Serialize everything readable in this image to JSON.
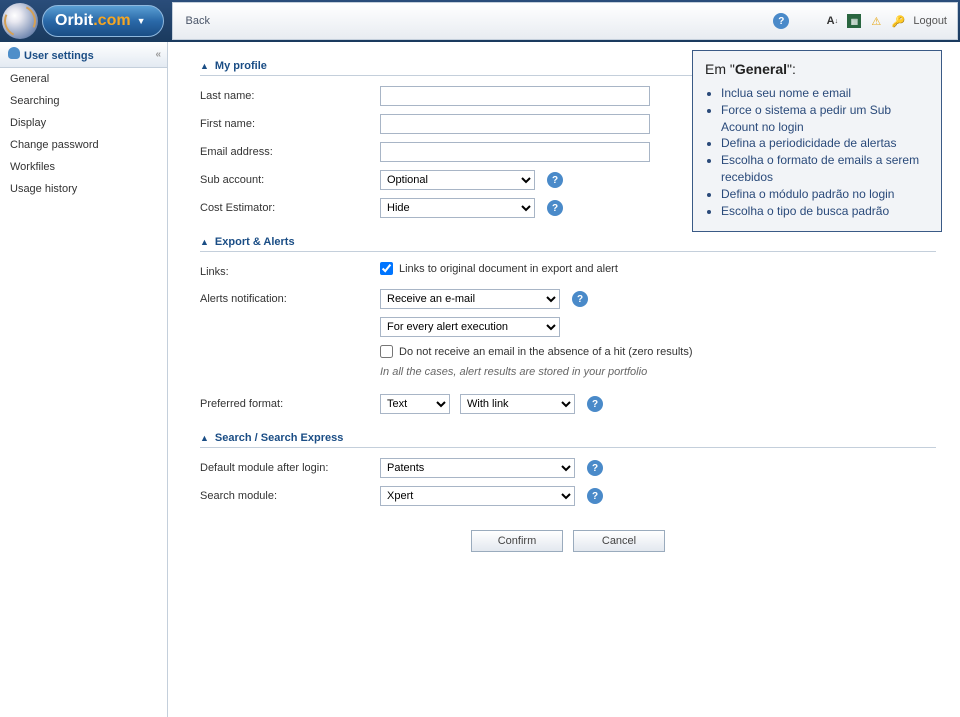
{
  "brand": {
    "name": "Orbit",
    "tld": ".com"
  },
  "topbar": {
    "back": "Back",
    "logout": "Logout"
  },
  "sidebar": {
    "title": "User settings",
    "items": [
      "General",
      "Searching",
      "Display",
      "Change password",
      "Workfiles",
      "Usage history"
    ]
  },
  "sections": {
    "profile": {
      "title": "My profile",
      "last_name_label": "Last name:",
      "first_name_label": "First name:",
      "email_label": "Email address:",
      "sub_account_label": "Sub account:",
      "sub_account_value": "Optional",
      "cost_estimator_label": "Cost Estimator:",
      "cost_estimator_value": "Hide"
    },
    "export": {
      "title": "Export & Alerts",
      "links_label": "Links:",
      "links_checkbox_label": "Links to original document in export and alert",
      "links_checked": true,
      "alerts_notif_label": "Alerts notification:",
      "alerts_notif_value": "Receive an e-mail",
      "alerts_freq_value": "For every alert execution",
      "no_receive_label": "Do not receive an email in the absence of a hit (zero results)",
      "no_receive_checked": false,
      "note": "In all the cases, alert results are stored in your portfolio",
      "preferred_format_label": "Preferred format:",
      "preferred_format_value": "Text",
      "preferred_link_value": "With link"
    },
    "search": {
      "title": "Search / Search Express",
      "default_module_label": "Default module after login:",
      "default_module_value": "Patents",
      "search_module_label": "Search module:",
      "search_module_value": "Xpert"
    }
  },
  "buttons": {
    "confirm": "Confirm",
    "cancel": "Cancel"
  },
  "tooltip": {
    "title_pre": "Em \"",
    "title_bold": "General",
    "title_post": "\":",
    "items": [
      "Inclua seu nome e email",
      "Force o sistema a pedir um Sub Acount no login",
      "Defina a periodicidade de alertas",
      "Escolha o formato de emails a serem recebidos",
      "Defina o módulo padrão no login",
      "Escolha o tipo de busca padrão"
    ]
  }
}
